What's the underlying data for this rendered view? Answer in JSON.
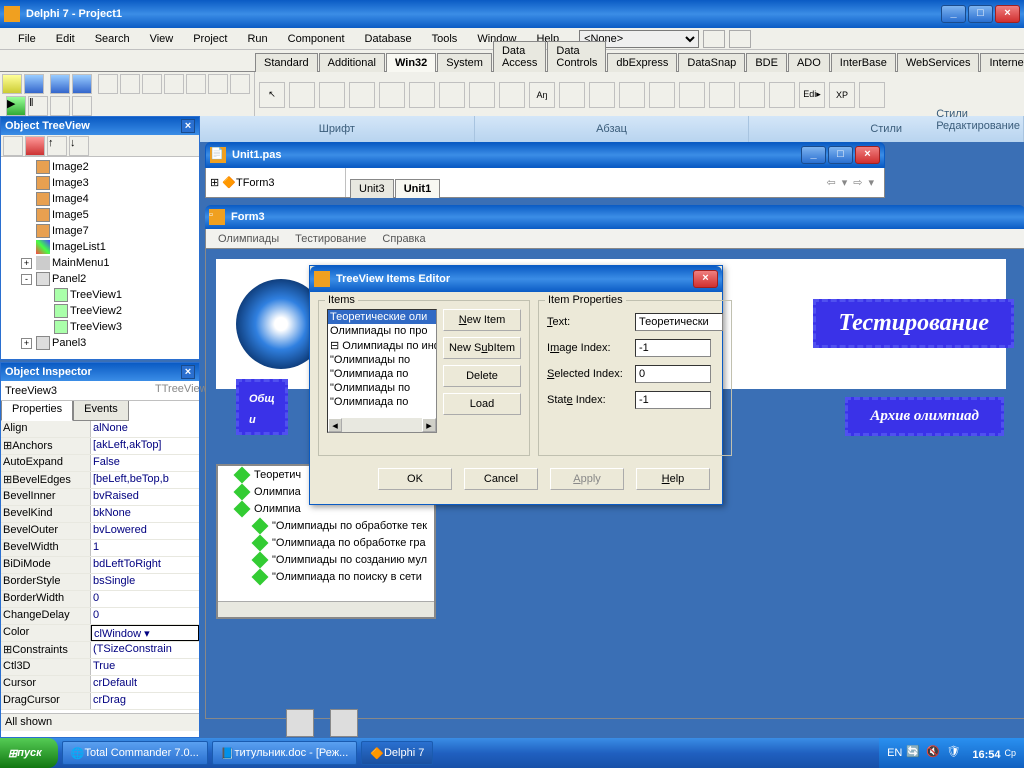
{
  "main": {
    "title": "Delphi 7 - Project1",
    "menus": [
      "File",
      "Edit",
      "Search",
      "View",
      "Project",
      "Run",
      "Component",
      "Database",
      "Tools",
      "Window",
      "Help"
    ],
    "combo": "<None>",
    "tabs": [
      "Standard",
      "Additional",
      "Win32",
      "System",
      "Data Access",
      "Data Controls",
      "dbExpress",
      "DataSnap",
      "BDE",
      "ADO",
      "InterBase",
      "WebServices",
      "Internet"
    ],
    "active_tab": "Win32"
  },
  "ribbon": {
    "g1": "Шрифт",
    "g2": "Абзац",
    "g3": "Стили",
    "s_label": "Стили",
    "edit_label": "Редактирование"
  },
  "otv": {
    "title": "Object TreeView",
    "items": [
      {
        "l": "Image2",
        "i": "img",
        "d": 1
      },
      {
        "l": "Image3",
        "i": "img",
        "d": 1
      },
      {
        "l": "Image4",
        "i": "img",
        "d": 1
      },
      {
        "l": "Image5",
        "i": "img",
        "d": 1
      },
      {
        "l": "Image7",
        "i": "img",
        "d": 1
      },
      {
        "l": "ImageList1",
        "i": "list",
        "d": 1
      },
      {
        "l": "MainMenu1",
        "i": "menu",
        "d": 1,
        "exp": "+"
      },
      {
        "l": "Panel2",
        "i": "panel",
        "d": 1,
        "exp": "-"
      },
      {
        "l": "TreeView1",
        "i": "tv",
        "d": 2
      },
      {
        "l": "TreeView2",
        "i": "tv",
        "d": 2
      },
      {
        "l": "TreeView3",
        "i": "tv",
        "d": 2
      },
      {
        "l": "Panel3",
        "i": "panel",
        "d": 1,
        "exp": "+"
      }
    ]
  },
  "oi": {
    "title": "Object Inspector",
    "obj": "TreeView3",
    "type": "TTreeView",
    "tabs": [
      "Properties",
      "Events"
    ],
    "props": [
      {
        "n": "Align",
        "v": "alNone"
      },
      {
        "n": "⊞Anchors",
        "v": "[akLeft,akTop]"
      },
      {
        "n": "AutoExpand",
        "v": "False"
      },
      {
        "n": "⊞BevelEdges",
        "v": "[beLeft,beTop,b"
      },
      {
        "n": "BevelInner",
        "v": "bvRaised"
      },
      {
        "n": "BevelKind",
        "v": "bkNone"
      },
      {
        "n": "BevelOuter",
        "v": "bvLowered"
      },
      {
        "n": "BevelWidth",
        "v": "1"
      },
      {
        "n": "BiDiMode",
        "v": "bdLeftToRight"
      },
      {
        "n": "BorderStyle",
        "v": "bsSingle"
      },
      {
        "n": "BorderWidth",
        "v": "0"
      },
      {
        "n": "ChangeDelay",
        "v": "0"
      },
      {
        "n": "Color",
        "v": "clWindow",
        "sel": true
      },
      {
        "n": "⊞Constraints",
        "v": "(TSizeConstrain"
      },
      {
        "n": "Ctl3D",
        "v": "True"
      },
      {
        "n": "Cursor",
        "v": "crDefault"
      },
      {
        "n": "DragCursor",
        "v": "crDrag"
      }
    ],
    "footer": "All shown"
  },
  "editor": {
    "title": "Unit1.pas",
    "combo_item": "TForm3",
    "tabs": [
      "Unit3",
      "Unit1"
    ],
    "active": "Unit1"
  },
  "form3": {
    "title": "Form3",
    "menus": [
      "Олимпиады",
      "Тестирование",
      "Справка"
    ],
    "brush1": "Тестирование",
    "brush2": "Архив олимпиад",
    "brush3a": "Общ",
    "brush3b": "и",
    "tv_rows": [
      "Теоретич",
      "Олимпиа",
      "Олимпиа",
      "\"Олимпиады по обработке тек",
      "\"Олимпиада по обработке гра",
      "\"Олимпиады по созданию мул",
      "\"Олимпиада по поиску в сети"
    ]
  },
  "dialog": {
    "title": "TreeView Items Editor",
    "items_label": "Items",
    "props_label": "Item Properties",
    "tree": [
      {
        "t": "Теоретические оли",
        "sel": true
      },
      {
        "t": "Олимпиады по про"
      },
      {
        "t": "⊟ Олимпиады по инф"
      },
      {
        "t": "  \"Олимпиады по"
      },
      {
        "t": "  \"Олимпиада по"
      },
      {
        "t": "  \"Олимпиады по"
      },
      {
        "t": "  \"Олимпиада по"
      }
    ],
    "btns": {
      "new": "New Item",
      "sub": "New SubItem",
      "del": "Delete",
      "load": "Load"
    },
    "fields": {
      "text_l": "Text:",
      "text_v": "Теоретически",
      "img_l": "Image Index:",
      "img_v": "-1",
      "sel_l": "Selected Index:",
      "sel_v": "0",
      "st_l": "State Index:",
      "st_v": "-1"
    },
    "ok": "OK",
    "cancel": "Cancel",
    "apply": "Apply",
    "help": "Help"
  },
  "taskbar": {
    "start": "пуск",
    "tasks": [
      {
        "l": "Total Commander 7.0..."
      },
      {
        "l": "титульник.doc - [Реж..."
      },
      {
        "l": "Delphi 7",
        "active": true
      }
    ],
    "lang": "EN",
    "clock": "16:54",
    "day": "Ср"
  }
}
